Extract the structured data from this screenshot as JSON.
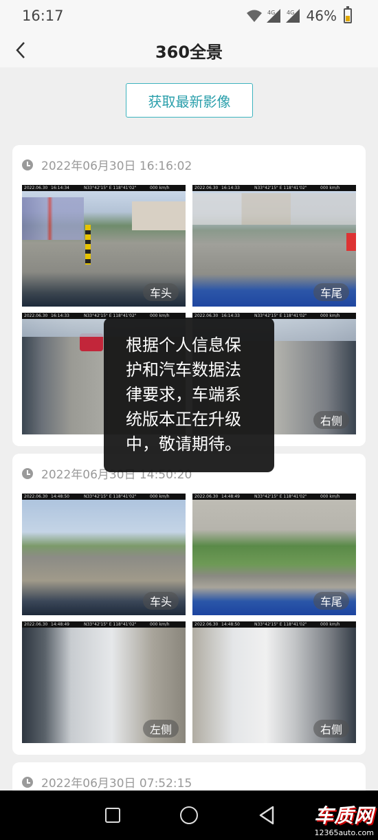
{
  "status": {
    "time": "16:17",
    "network1": "4G",
    "network2": "4G",
    "battery": "46%",
    "battery_level": 0.46
  },
  "header": {
    "title": "360全景"
  },
  "refresh_button": "获取最新影像",
  "records": [
    {
      "time": "2022年06月30日 16:16:02",
      "photos": [
        {
          "label": "车头",
          "hud_date": "2022.06.30",
          "hud_time": "16:14:34",
          "hud_gps": "N33°42'15\"  E 118°41'02\"",
          "hud_speed": "000 km/h"
        },
        {
          "label": "车尾",
          "hud_date": "2022.06.30",
          "hud_time": "16:14:33",
          "hud_gps": "N33°42'15\"  E 118°41'02\"",
          "hud_speed": "000 km/h"
        },
        {
          "label": "",
          "hud_date": "2022.06.30",
          "hud_time": "16:14:33",
          "hud_gps": "N33°42'15\"  E 118°41'02\"",
          "hud_speed": "000 km/h"
        },
        {
          "label": "右侧",
          "hud_date": "2022.06.30",
          "hud_time": "16:14:33",
          "hud_gps": "N33°42'15\"  E 118°41'02\"",
          "hud_speed": "000 km/h"
        }
      ]
    },
    {
      "time": "2022年06月30日 14:50:20",
      "photos": [
        {
          "label": "车头",
          "hud_date": "2022.06.30",
          "hud_time": "14:48:50",
          "hud_gps": "N33°42'15\"  E 118°41'02\"",
          "hud_speed": "000 km/h"
        },
        {
          "label": "车尾",
          "hud_date": "2022.06.30",
          "hud_time": "14:48:49",
          "hud_gps": "N33°42'15\"  E 118°41'02\"",
          "hud_speed": "000 km/h"
        },
        {
          "label": "左侧",
          "hud_date": "2022.06.30",
          "hud_time": "14:48:49",
          "hud_gps": "N33°42'15\"  E 118°41'02\"",
          "hud_speed": "000 km/h"
        },
        {
          "label": "右侧",
          "hud_date": "2022.06.30",
          "hud_time": "14:48:50",
          "hud_gps": "N33°42'15\"  E 118°41'02\"",
          "hud_speed": "000 km/h"
        }
      ]
    },
    {
      "time": "2022年06月30日 07:52:15",
      "photos": []
    }
  ],
  "toast": {
    "line1": "根据个人信息保",
    "line2": "护和汽车数据法",
    "line3": "律要求，车端系",
    "line4": "统版本正在升级",
    "line5": "中，敬请期待。"
  },
  "watermark": {
    "logo": "车质网",
    "url": "12365auto.com"
  },
  "colors": {
    "accent": "#2a9fab",
    "toast_bg": "#111111"
  }
}
